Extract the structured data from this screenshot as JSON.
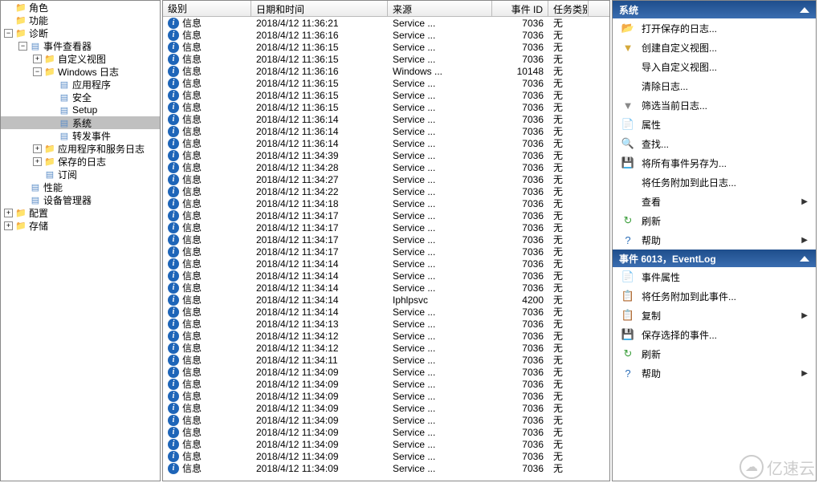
{
  "tree": [
    {
      "indent": 0,
      "toggle": "",
      "icon": "folder",
      "label": "角色"
    },
    {
      "indent": 0,
      "toggle": "",
      "icon": "folder",
      "label": "功能"
    },
    {
      "indent": 0,
      "toggle": "−",
      "icon": "folder",
      "label": "诊断"
    },
    {
      "indent": 1,
      "toggle": "−",
      "icon": "page",
      "label": "事件查看器"
    },
    {
      "indent": 2,
      "toggle": "+",
      "icon": "folder",
      "label": "自定义视图"
    },
    {
      "indent": 2,
      "toggle": "−",
      "icon": "folder",
      "label": "Windows 日志"
    },
    {
      "indent": 3,
      "toggle": "",
      "icon": "page",
      "label": "应用程序"
    },
    {
      "indent": 3,
      "toggle": "",
      "icon": "page",
      "label": "安全"
    },
    {
      "indent": 3,
      "toggle": "",
      "icon": "page",
      "label": "Setup"
    },
    {
      "indent": 3,
      "toggle": "",
      "icon": "page",
      "label": "系统",
      "selected": true
    },
    {
      "indent": 3,
      "toggle": "",
      "icon": "page",
      "label": "转发事件"
    },
    {
      "indent": 2,
      "toggle": "+",
      "icon": "folder",
      "label": "应用程序和服务日志"
    },
    {
      "indent": 2,
      "toggle": "+",
      "icon": "folder",
      "label": "保存的日志"
    },
    {
      "indent": 2,
      "toggle": "",
      "icon": "page",
      "label": "订阅"
    },
    {
      "indent": 1,
      "toggle": "",
      "icon": "page",
      "label": "性能"
    },
    {
      "indent": 1,
      "toggle": "",
      "icon": "page",
      "label": "设备管理器"
    },
    {
      "indent": 0,
      "toggle": "+",
      "icon": "folder",
      "label": "配置"
    },
    {
      "indent": 0,
      "toggle": "+",
      "icon": "folder",
      "label": "存储"
    }
  ],
  "grid": {
    "headers": {
      "level": "级别",
      "date": "日期和时间",
      "src": "来源",
      "id": "事件 ID",
      "task": "任务类别"
    },
    "rows": [
      {
        "level": "信息",
        "date": "2018/4/12 11:36:21",
        "src": "Service ...",
        "id": "7036",
        "task": "无"
      },
      {
        "level": "信息",
        "date": "2018/4/12 11:36:16",
        "src": "Service ...",
        "id": "7036",
        "task": "无"
      },
      {
        "level": "信息",
        "date": "2018/4/12 11:36:15",
        "src": "Service ...",
        "id": "7036",
        "task": "无"
      },
      {
        "level": "信息",
        "date": "2018/4/12 11:36:15",
        "src": "Service ...",
        "id": "7036",
        "task": "无"
      },
      {
        "level": "信息",
        "date": "2018/4/12 11:36:16",
        "src": "Windows ...",
        "id": "10148",
        "task": "无"
      },
      {
        "level": "信息",
        "date": "2018/4/12 11:36:15",
        "src": "Service ...",
        "id": "7036",
        "task": "无"
      },
      {
        "level": "信息",
        "date": "2018/4/12 11:36:15",
        "src": "Service ...",
        "id": "7036",
        "task": "无"
      },
      {
        "level": "信息",
        "date": "2018/4/12 11:36:15",
        "src": "Service ...",
        "id": "7036",
        "task": "无"
      },
      {
        "level": "信息",
        "date": "2018/4/12 11:36:14",
        "src": "Service ...",
        "id": "7036",
        "task": "无"
      },
      {
        "level": "信息",
        "date": "2018/4/12 11:36:14",
        "src": "Service ...",
        "id": "7036",
        "task": "无"
      },
      {
        "level": "信息",
        "date": "2018/4/12 11:36:14",
        "src": "Service ...",
        "id": "7036",
        "task": "无"
      },
      {
        "level": "信息",
        "date": "2018/4/12 11:34:39",
        "src": "Service ...",
        "id": "7036",
        "task": "无"
      },
      {
        "level": "信息",
        "date": "2018/4/12 11:34:28",
        "src": "Service ...",
        "id": "7036",
        "task": "无"
      },
      {
        "level": "信息",
        "date": "2018/4/12 11:34:27",
        "src": "Service ...",
        "id": "7036",
        "task": "无"
      },
      {
        "level": "信息",
        "date": "2018/4/12 11:34:22",
        "src": "Service ...",
        "id": "7036",
        "task": "无"
      },
      {
        "level": "信息",
        "date": "2018/4/12 11:34:18",
        "src": "Service ...",
        "id": "7036",
        "task": "无"
      },
      {
        "level": "信息",
        "date": "2018/4/12 11:34:17",
        "src": "Service ...",
        "id": "7036",
        "task": "无"
      },
      {
        "level": "信息",
        "date": "2018/4/12 11:34:17",
        "src": "Service ...",
        "id": "7036",
        "task": "无"
      },
      {
        "level": "信息",
        "date": "2018/4/12 11:34:17",
        "src": "Service ...",
        "id": "7036",
        "task": "无"
      },
      {
        "level": "信息",
        "date": "2018/4/12 11:34:17",
        "src": "Service ...",
        "id": "7036",
        "task": "无"
      },
      {
        "level": "信息",
        "date": "2018/4/12 11:34:14",
        "src": "Service ...",
        "id": "7036",
        "task": "无"
      },
      {
        "level": "信息",
        "date": "2018/4/12 11:34:14",
        "src": "Service ...",
        "id": "7036",
        "task": "无"
      },
      {
        "level": "信息",
        "date": "2018/4/12 11:34:14",
        "src": "Service ...",
        "id": "7036",
        "task": "无"
      },
      {
        "level": "信息",
        "date": "2018/4/12 11:34:14",
        "src": "Iphlpsvc",
        "id": "4200",
        "task": "无"
      },
      {
        "level": "信息",
        "date": "2018/4/12 11:34:14",
        "src": "Service ...",
        "id": "7036",
        "task": "无"
      },
      {
        "level": "信息",
        "date": "2018/4/12 11:34:13",
        "src": "Service ...",
        "id": "7036",
        "task": "无"
      },
      {
        "level": "信息",
        "date": "2018/4/12 11:34:12",
        "src": "Service ...",
        "id": "7036",
        "task": "无"
      },
      {
        "level": "信息",
        "date": "2018/4/12 11:34:12",
        "src": "Service ...",
        "id": "7036",
        "task": "无"
      },
      {
        "level": "信息",
        "date": "2018/4/12 11:34:11",
        "src": "Service ...",
        "id": "7036",
        "task": "无"
      },
      {
        "level": "信息",
        "date": "2018/4/12 11:34:09",
        "src": "Service ...",
        "id": "7036",
        "task": "无"
      },
      {
        "level": "信息",
        "date": "2018/4/12 11:34:09",
        "src": "Service ...",
        "id": "7036",
        "task": "无"
      },
      {
        "level": "信息",
        "date": "2018/4/12 11:34:09",
        "src": "Service ...",
        "id": "7036",
        "task": "无"
      },
      {
        "level": "信息",
        "date": "2018/4/12 11:34:09",
        "src": "Service ...",
        "id": "7036",
        "task": "无"
      },
      {
        "level": "信息",
        "date": "2018/4/12 11:34:09",
        "src": "Service ...",
        "id": "7036",
        "task": "无"
      },
      {
        "level": "信息",
        "date": "2018/4/12 11:34:09",
        "src": "Service ...",
        "id": "7036",
        "task": "无"
      },
      {
        "level": "信息",
        "date": "2018/4/12 11:34:09",
        "src": "Service ...",
        "id": "7036",
        "task": "无"
      },
      {
        "level": "信息",
        "date": "2018/4/12 11:34:09",
        "src": "Service ...",
        "id": "7036",
        "task": "无"
      },
      {
        "level": "信息",
        "date": "2018/4/12 11:34:09",
        "src": "Service ...",
        "id": "7036",
        "task": "无"
      }
    ]
  },
  "actions1": {
    "title": "系统",
    "items": [
      {
        "icon": "📂",
        "label": "打开保存的日志..."
      },
      {
        "icon": "▼",
        "label": "创建自定义视图...",
        "iconColor": "#d4a83a"
      },
      {
        "icon": "",
        "label": "导入自定义视图..."
      },
      {
        "icon": "",
        "label": "清除日志..."
      },
      {
        "icon": "▼",
        "label": "筛选当前日志...",
        "iconColor": "#888"
      },
      {
        "icon": "📄",
        "label": "属性"
      },
      {
        "icon": "🔍",
        "label": "查找..."
      },
      {
        "icon": "💾",
        "label": "将所有事件另存为..."
      },
      {
        "icon": "",
        "label": "将任务附加到此日志..."
      },
      {
        "icon": "",
        "label": "查看",
        "arrow": true
      },
      {
        "icon": "↻",
        "label": "刷新",
        "iconColor": "#3a9e3a"
      },
      {
        "icon": "?",
        "label": "帮助",
        "arrow": true,
        "iconColor": "#2a6db8"
      }
    ]
  },
  "actions2": {
    "title": "事件 6013，EventLog",
    "items": [
      {
        "icon": "📄",
        "label": "事件属性"
      },
      {
        "icon": "📋",
        "label": "将任务附加到此事件..."
      },
      {
        "icon": "📋",
        "label": "复制",
        "arrow": true
      },
      {
        "icon": "💾",
        "label": "保存选择的事件..."
      },
      {
        "icon": "↻",
        "label": "刷新",
        "iconColor": "#3a9e3a"
      },
      {
        "icon": "?",
        "label": "帮助",
        "arrow": true,
        "iconColor": "#2a6db8"
      }
    ]
  },
  "watermark": "亿速云"
}
